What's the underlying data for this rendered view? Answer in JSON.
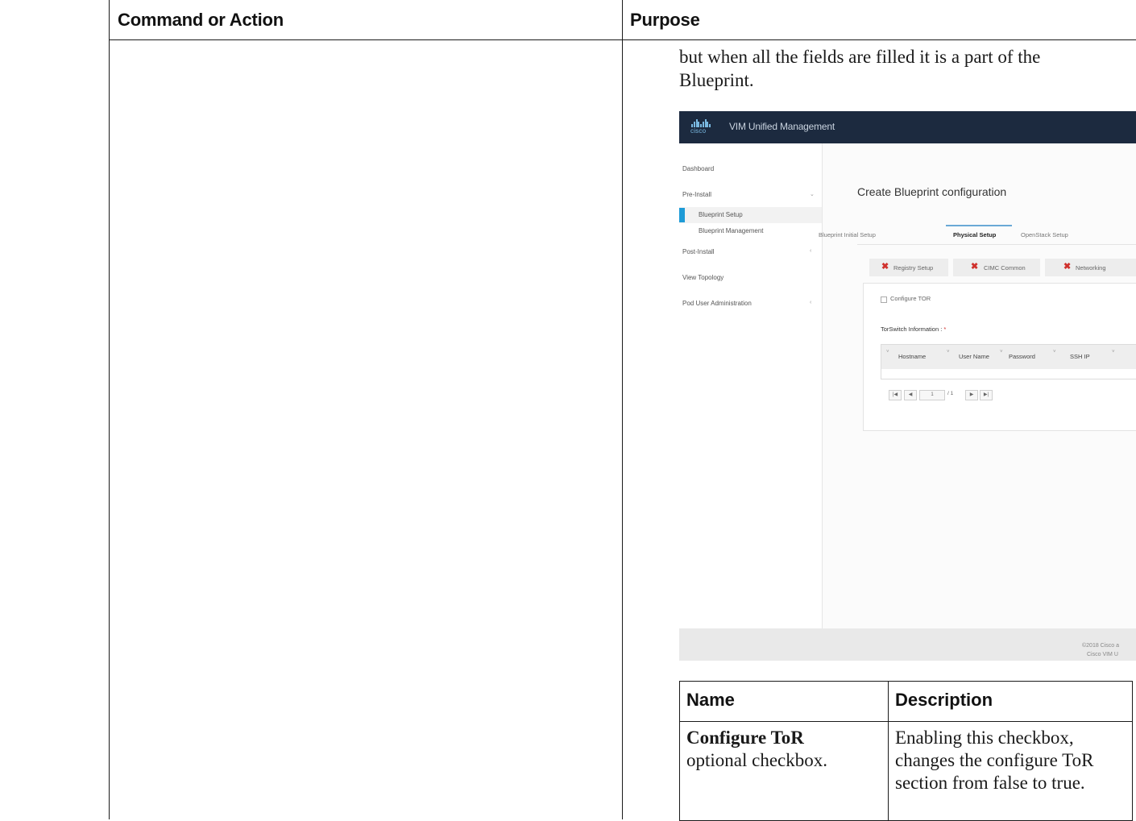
{
  "outer_table": {
    "col1_header": "Command or Action",
    "col2_header": "Purpose",
    "purpose_text": "but when all the fields are filled it is a part of the Blueprint."
  },
  "screenshot": {
    "logo_text": "cisco",
    "app_title": "VIM Unified Management",
    "nav": {
      "dashboard": "Dashboard",
      "pre_install": "Pre-Install",
      "blueprint_setup": "Blueprint Setup",
      "blueprint_management": "Blueprint Management",
      "post_install": "Post-Install",
      "view_topology": "View Topology",
      "pod_user_admin": "Pod User Administration"
    },
    "page_title": "Create Blueprint configuration",
    "tabs": {
      "initial": "Blueprint Initial Setup",
      "physical": "Physical Setup",
      "openstack": "OpenStack Setup"
    },
    "steps": {
      "registry": "Registry Setup",
      "cimc": "CIMC Common",
      "networking": "Networking"
    },
    "configure_tor": "Configure TOR",
    "torswitch_label": "TorSwitch Information :",
    "required_mark": "*",
    "columns": {
      "hostname": "Hostname",
      "username": "User Name",
      "password": "Password",
      "ssh_ip": "SSH IP"
    },
    "pager": {
      "first": "|◀",
      "prev": "◀",
      "page_value": "1",
      "of_total": "/ 1",
      "next": "▶",
      "last": "▶|"
    },
    "footer_line1": "©2018 Cisco a",
    "footer_line2": "Cisco VIM U"
  },
  "inner_table": {
    "header_name": "Name",
    "header_desc": "Description",
    "row_name_bold": "Configure ToR",
    "row_name_rest": "optional checkbox.",
    "row_desc": "Enabling this checkbox, changes the configure ToR section from false to true."
  }
}
